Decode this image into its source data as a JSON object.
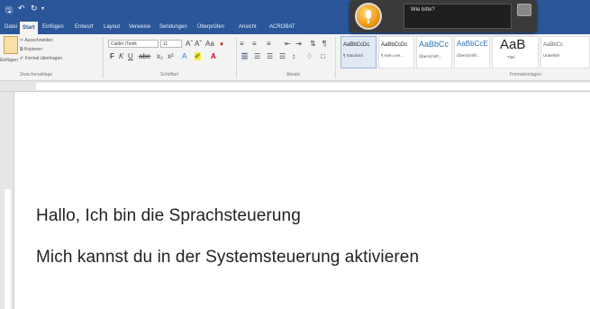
{
  "colors": {
    "accent": "#2b579a",
    "ribbon_bg": "#f3f3f3",
    "assistant_bg": "#3a3a3a"
  },
  "qat": {
    "save_icon": "save-icon",
    "undo_icon": "undo-icon",
    "redo_icon": "redo-icon",
    "customize_icon": "qat-dropdown-icon"
  },
  "tabs": [
    "Datei",
    "Start",
    "Einfügen",
    "Entwurf",
    "Layout",
    "Verweise",
    "Sendungen",
    "Überprüfen",
    "Ansicht",
    "ACROBAT"
  ],
  "active_tab": "Start",
  "clipboard": {
    "paste_label": "Einfügen",
    "cut_label": "Ausschneiden",
    "copy_label": "Kopieren",
    "format_painter_label": "Format übertragen",
    "group_label": "Zwischenablage"
  },
  "font": {
    "font_name": "Calibri (Textk",
    "font_size": "11",
    "group_label": "Schriftart"
  },
  "paragraph": {
    "group_label": "Absatz"
  },
  "styles": {
    "group_label": "Formatvorlagen",
    "items": [
      {
        "sample": "AaBbCcDc",
        "name": "¶ Standard"
      },
      {
        "sample": "AaBbCcDc",
        "name": "¶ Kein Lee..."
      },
      {
        "sample": "AaBbCc",
        "name": "Überschrift..."
      },
      {
        "sample": "AaBbCcE",
        "name": "Überschrift..."
      },
      {
        "sample": "AaB",
        "name": "Titel"
      },
      {
        "sample": "AaBbCc",
        "name": "Untertitel"
      }
    ]
  },
  "assistant": {
    "prompt": "Wie bitte?",
    "icon": "voice-assistant-orb-icon"
  },
  "document": {
    "lines": [
      "Hallo, Ich bin die Sprachsteuerung",
      "Mich kannst du in der Systemsteuerung aktivieren"
    ]
  }
}
